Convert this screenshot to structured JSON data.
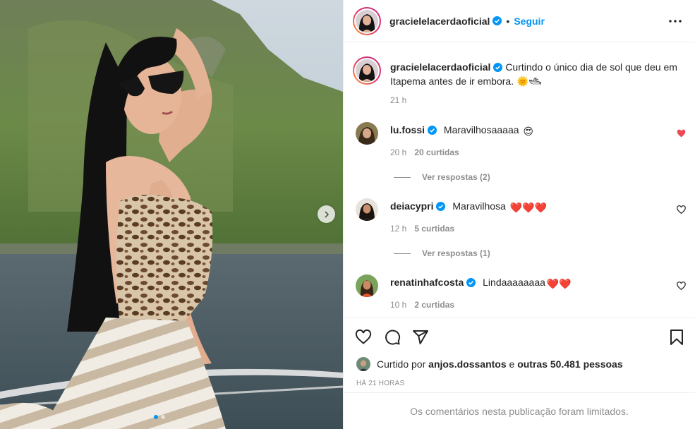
{
  "post": {
    "author": "gracielelacerdaoficial",
    "separator": "•",
    "follow_label": "Seguir",
    "caption_text": "Curtindo o único dia de sol que deu em Itapema antes de ir embora. 🌞🛥",
    "caption_time": "21 h"
  },
  "comments": [
    {
      "user": "lu.fossi",
      "text": "Maravilhosaaaaa",
      "emoji": "😍",
      "time": "20 h",
      "likes": "20 curtidas",
      "replies": "Ver respostas (2)",
      "liked": true
    },
    {
      "user": "deiacypri",
      "text": "Maravilhosa",
      "emoji": "❤️❤️❤️",
      "time": "12 h",
      "likes": "5 curtidas",
      "replies": "Ver respostas (1)",
      "liked": false
    },
    {
      "user": "renatinhafcosta",
      "text": "Lindaaaaaaaa",
      "emoji": "❤️❤️",
      "time": "10 h",
      "likes": "2 curtidas",
      "liked": false
    }
  ],
  "likes": {
    "prefix": "Curtido por",
    "user": "anjos.dossantos",
    "middle": "e",
    "others": "outras 50.481 pessoas"
  },
  "time_ago": "HÁ 21 HORAS",
  "comments_limited": "Os comentários nesta publicação foram limitados.",
  "icons": {
    "like": "heart-icon",
    "comment": "comment-icon",
    "share": "share-icon",
    "save": "bookmark-icon",
    "more": "more-options-icon",
    "next": "chevron-right-icon",
    "verified": "verified-badge-icon"
  },
  "colors": {
    "accent": "#0095f6",
    "liked_heart": "#ed4956",
    "muted": "#8e8e8e",
    "text": "#262626",
    "border": "#efefef"
  }
}
